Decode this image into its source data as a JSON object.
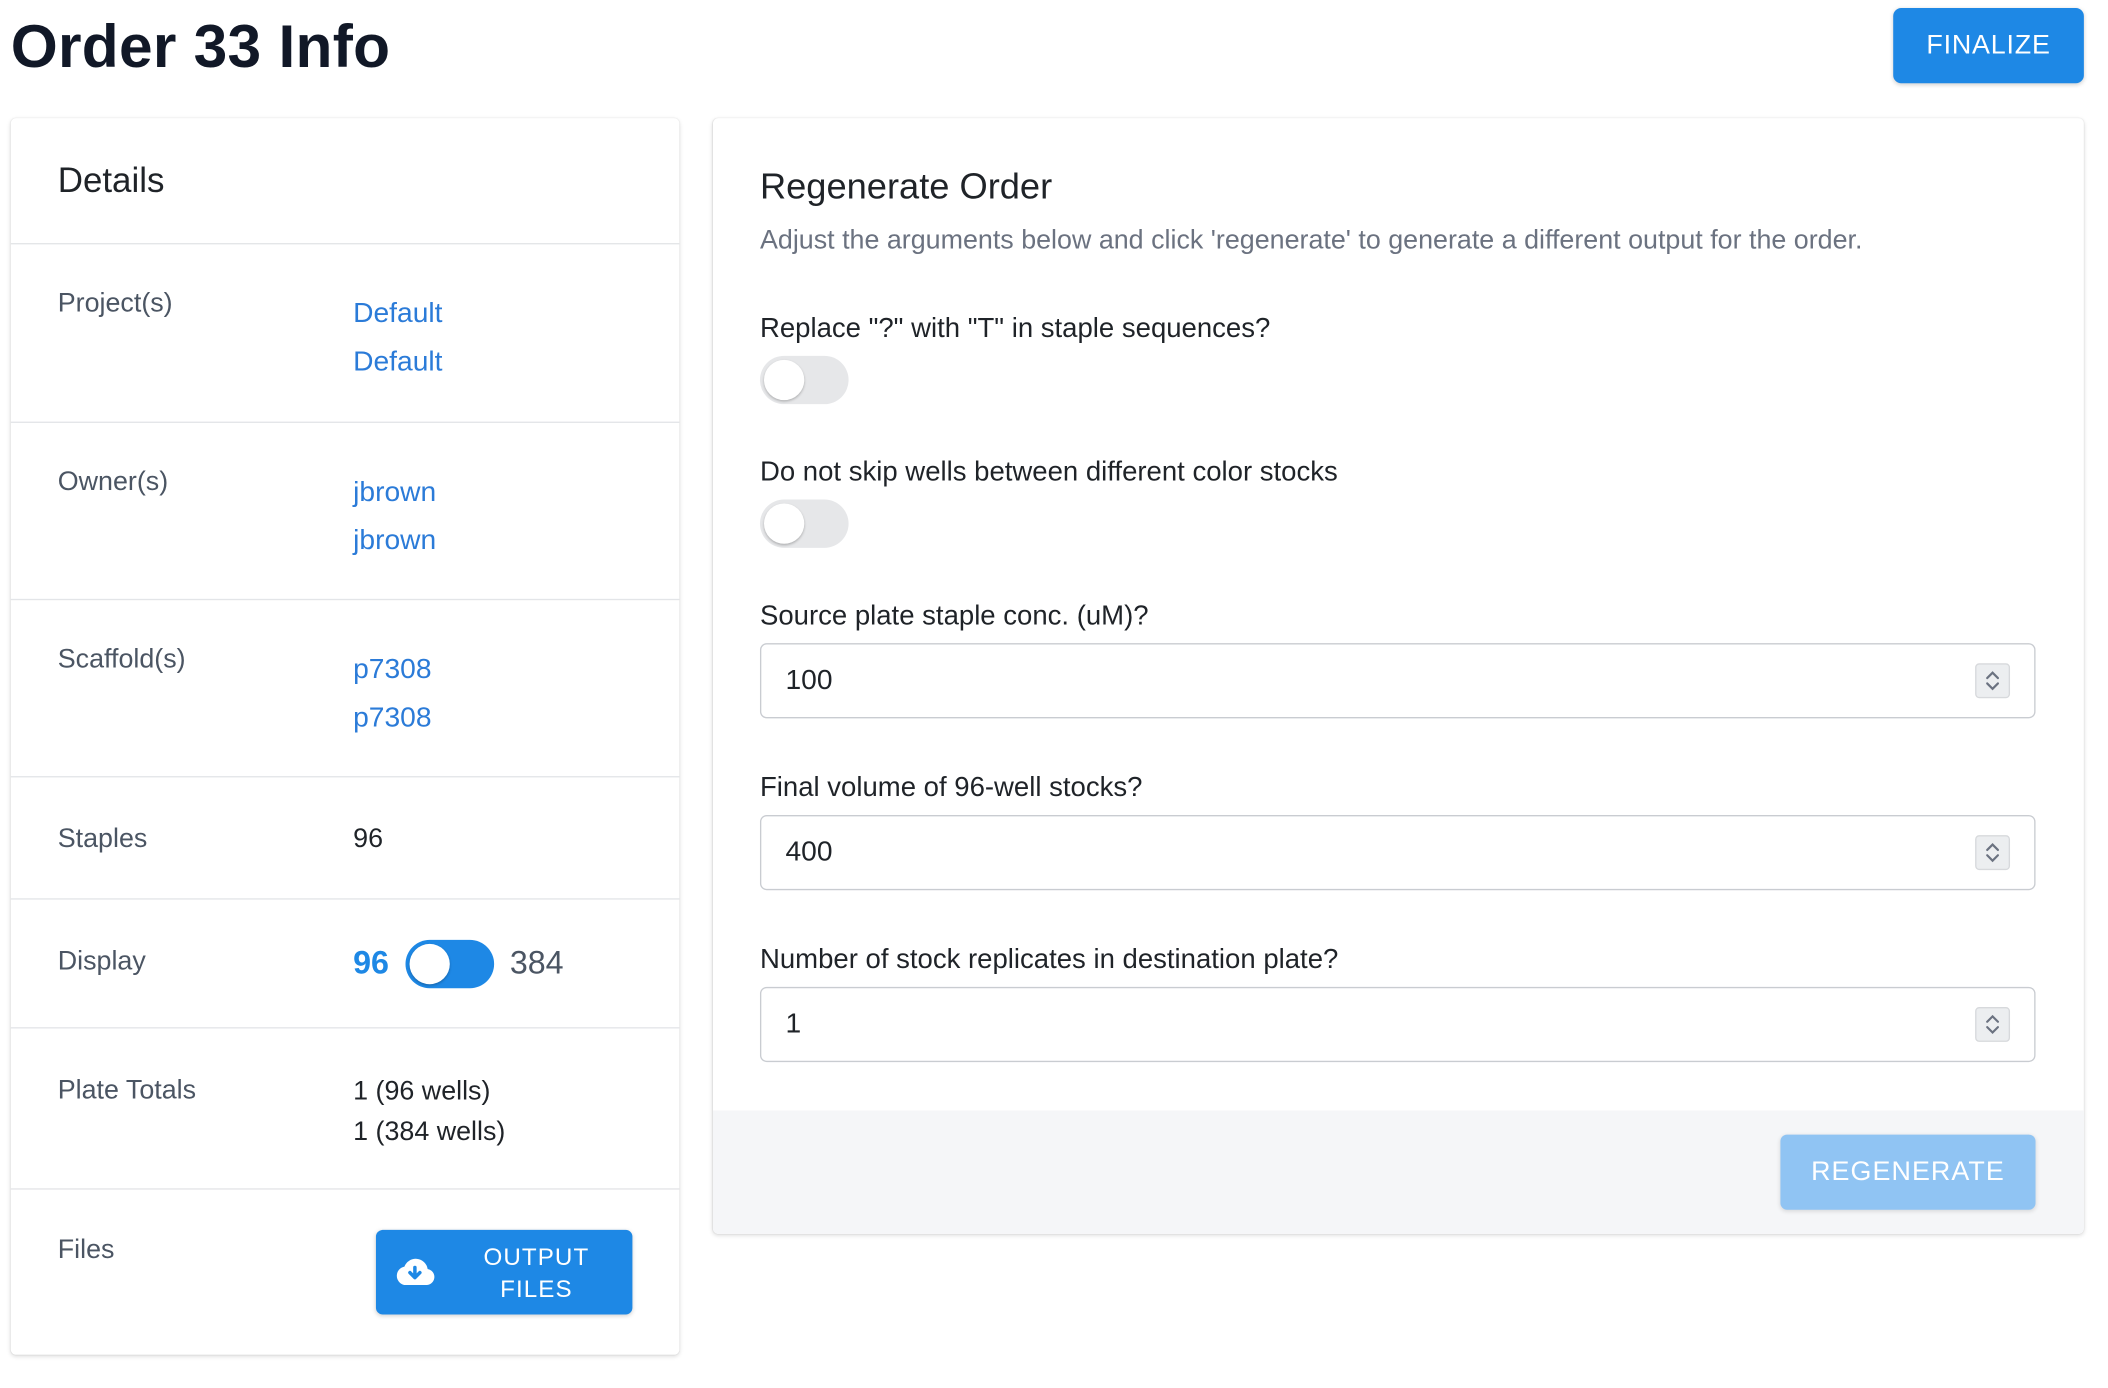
{
  "page": {
    "title": "Order 33 Info",
    "finalize_label": "FINALIZE"
  },
  "details": {
    "heading": "Details",
    "projects": {
      "label": "Project(s)",
      "items": [
        "Default",
        "Default"
      ]
    },
    "owners": {
      "label": "Owner(s)",
      "items": [
        "jbrown",
        "jbrown"
      ]
    },
    "scaffolds": {
      "label": "Scaffold(s)",
      "items": [
        "p7308",
        "p7308"
      ]
    },
    "staples": {
      "label": "Staples",
      "value": "96"
    },
    "display": {
      "label": "Display",
      "left_option": "96",
      "right_option": "384",
      "selected": "96"
    },
    "plate_totals": {
      "label": "Plate Totals",
      "lines": [
        "1 (96 wells)",
        "1 (384 wells)"
      ]
    },
    "files": {
      "label": "Files",
      "button_line1": "OUTPUT",
      "button_line2": "FILES",
      "icon": "cloud-download-icon"
    }
  },
  "regenerate": {
    "title": "Regenerate Order",
    "subtitle": "Adjust the arguments below and click 'regenerate' to generate a different output for the order.",
    "replace_toggle": {
      "label": "Replace \"?\" with \"T\" in staple sequences?",
      "checked": false
    },
    "skip_toggle": {
      "label": "Do not skip wells between different color stocks",
      "checked": false
    },
    "conc": {
      "label": "Source plate staple conc. (uM)?",
      "value": "100"
    },
    "volume": {
      "label": "Final volume of 96-well stocks?",
      "value": "400"
    },
    "replicates": {
      "label": "Number of stock replicates in destination plate?",
      "value": "1"
    },
    "button_label": "REGENERATE"
  },
  "colors": {
    "primary": "#1e88e5",
    "primary_disabled": "#90c4f3",
    "link": "#2b7bd8",
    "footer_bg": "#f5f6f8"
  }
}
